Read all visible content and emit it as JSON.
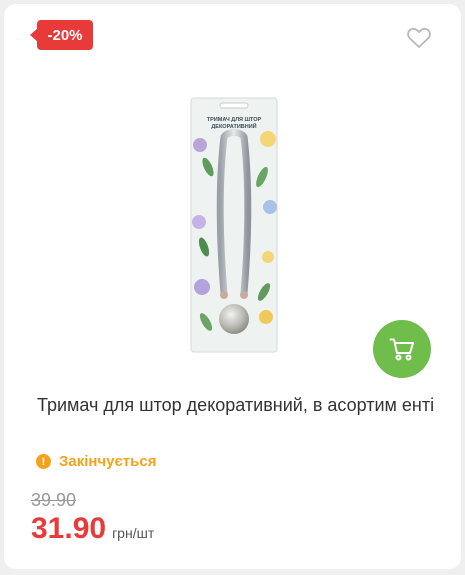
{
  "badge": {
    "discount": "-20%"
  },
  "product": {
    "title": "Тримач для штор декоративний, в асортим енті",
    "package_label": "ТРИМАЧ ДЛЯ ШТОР ДЕКОРАТИВНИЙ",
    "status": "Закінчується"
  },
  "price": {
    "old": "39.90",
    "current": "31.90",
    "unit": "грн/шт"
  },
  "colors": {
    "accent_red": "#e93a3a",
    "status_orange": "#f3a21a",
    "cart_green": "#6fbd4a"
  },
  "icons": {
    "favorite": "heart-outline-icon",
    "cart": "shopping-cart-icon",
    "status": "exclamation-icon"
  }
}
